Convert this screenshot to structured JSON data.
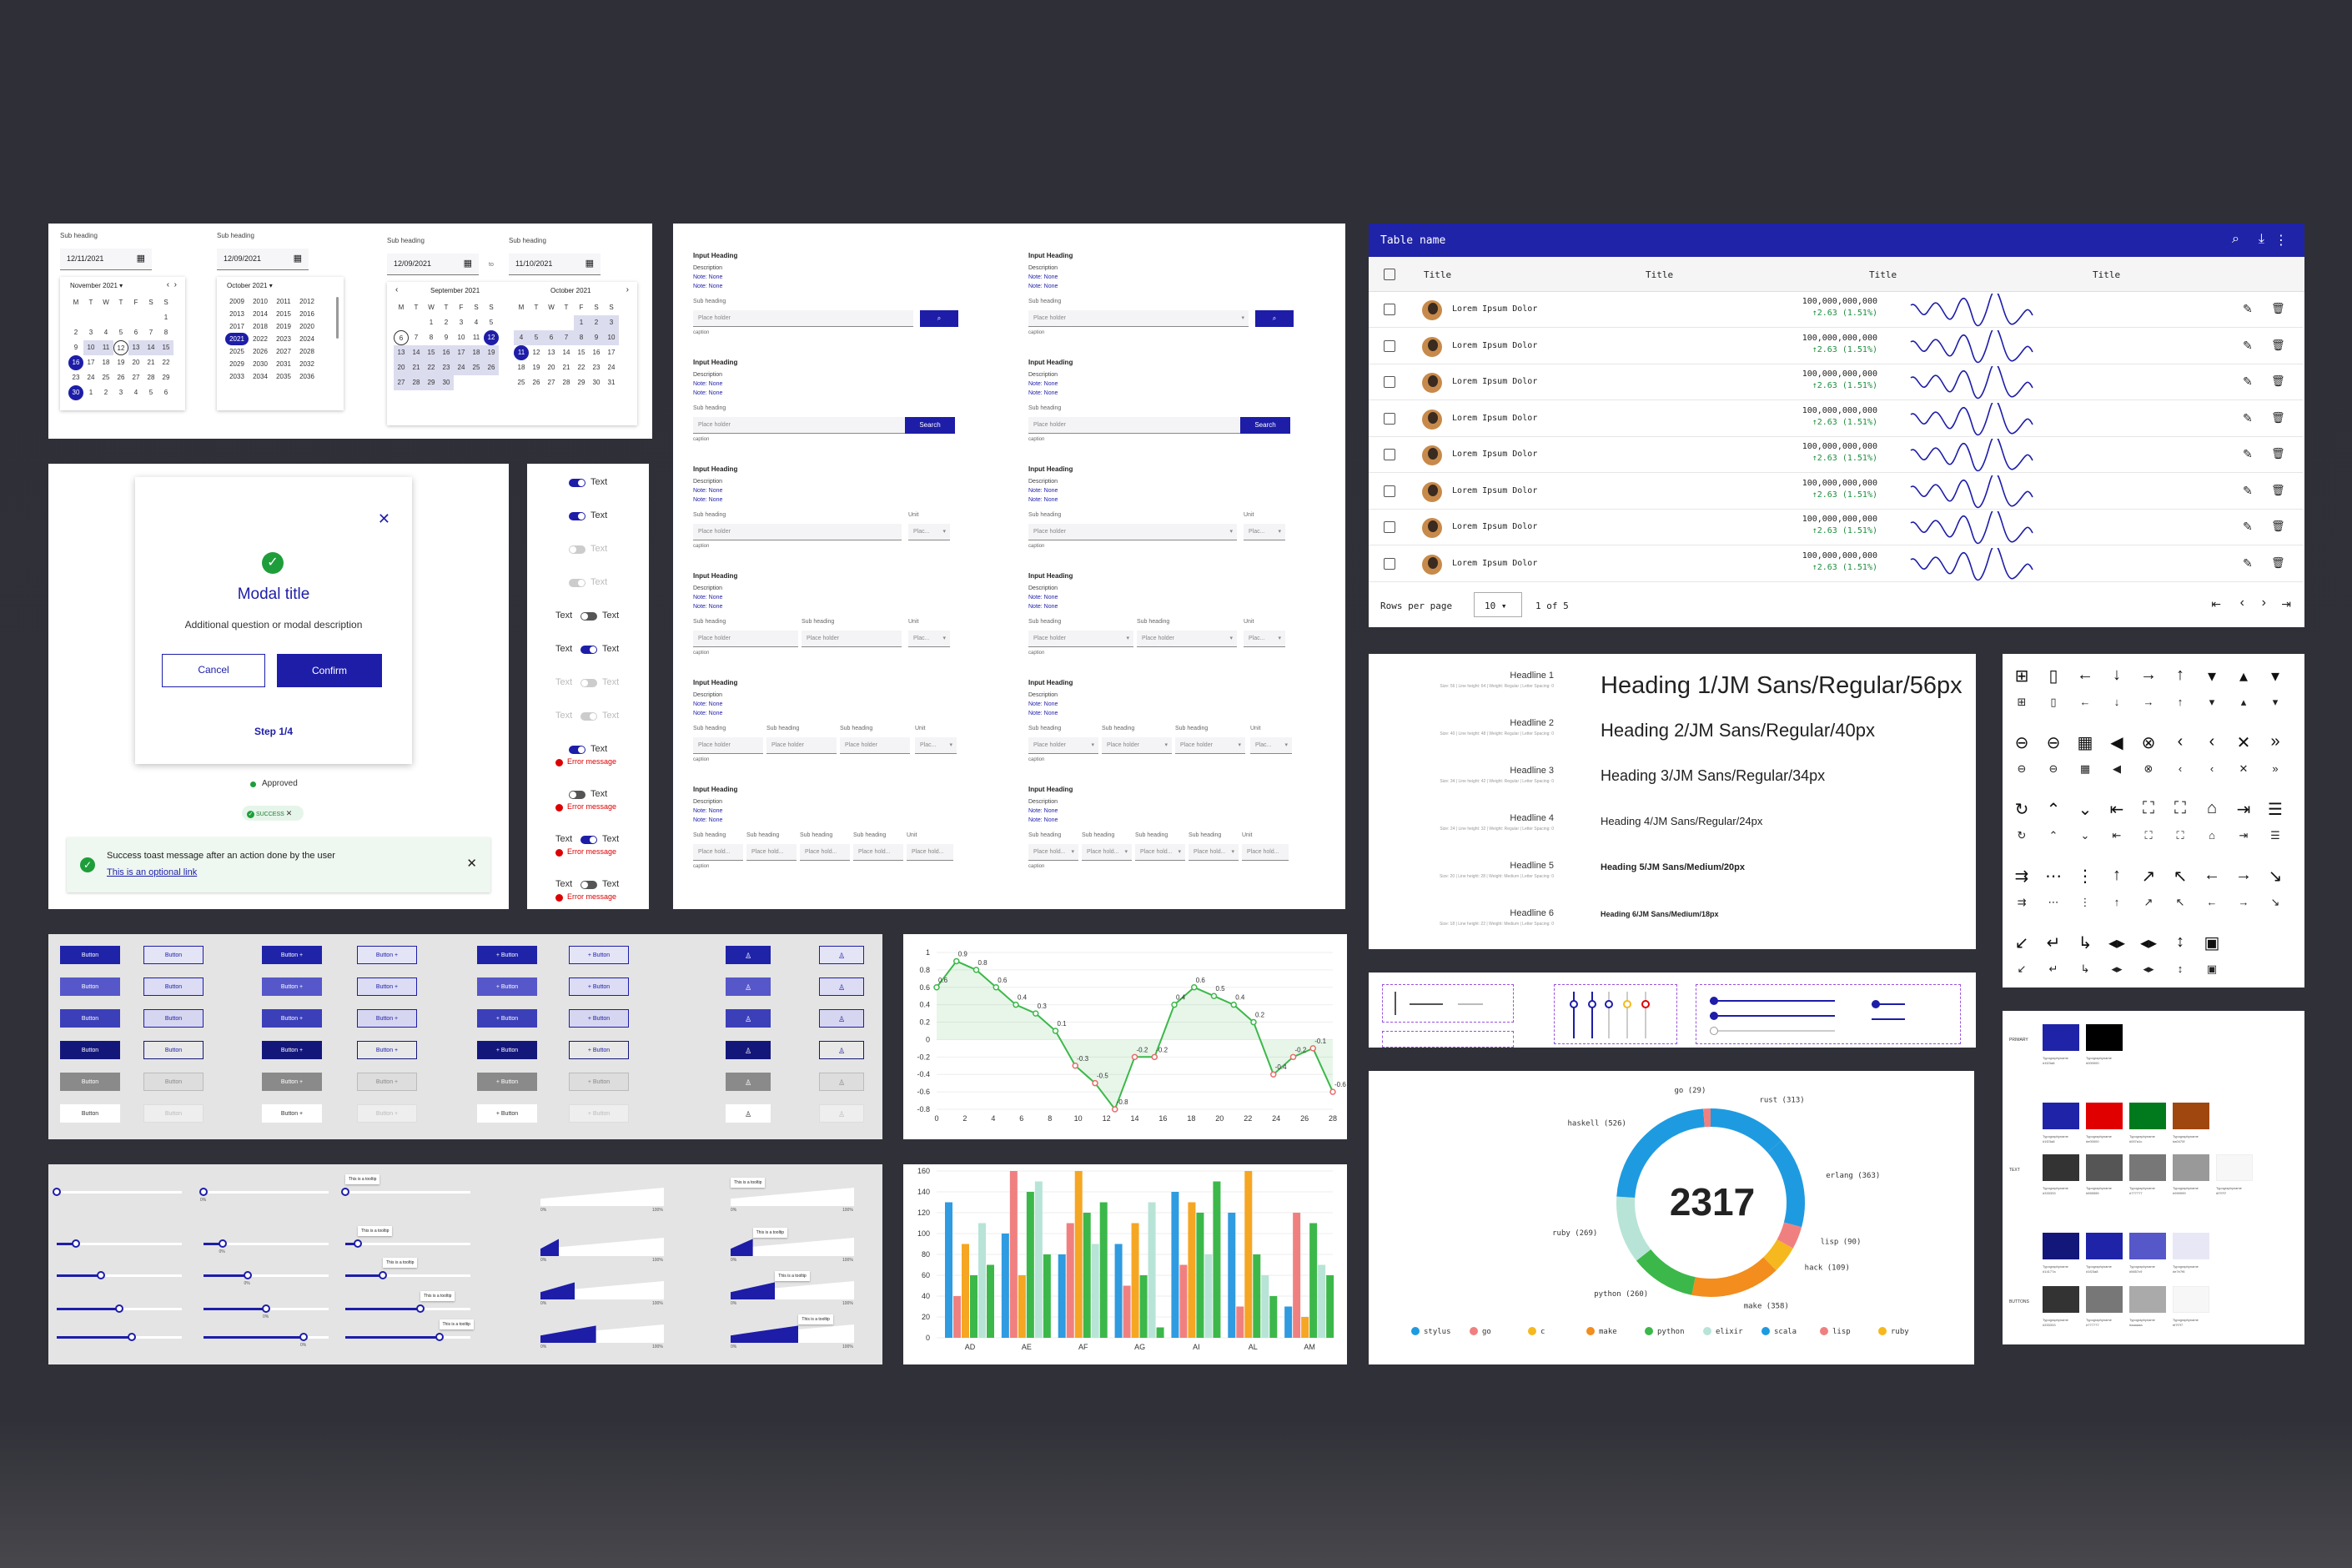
{
  "calendar": {
    "sub": "Sub heading",
    "c1": {
      "date": "12/11/2021",
      "month": "November 2021",
      "days": [
        "M",
        "T",
        "W",
        "T",
        "F",
        "S",
        "S"
      ],
      "cells": [
        "",
        "",
        "",
        "",
        "",
        "",
        "1",
        "2",
        "3",
        "4",
        "5",
        "6",
        "7",
        "8",
        "9",
        "10",
        "11",
        "12",
        "13",
        "14",
        "15",
        "16",
        "17",
        "18",
        "19",
        "20",
        "21",
        "22",
        "23",
        "24",
        "25",
        "26",
        "27",
        "28",
        "29",
        "30",
        "1",
        "2",
        "3",
        "4",
        "5",
        "6"
      ]
    },
    "c2": {
      "date": "12/09/2021",
      "month": "October 2021",
      "years": [
        "2009",
        "2010",
        "2011",
        "2012",
        "2013",
        "2014",
        "2015",
        "2016",
        "2017",
        "2018",
        "2019",
        "2020",
        "2021",
        "2022",
        "2023",
        "2024",
        "2025",
        "2026",
        "2027",
        "2028",
        "2029",
        "2030",
        "2031",
        "2032",
        "2033",
        "2034",
        "2035",
        "2036"
      ]
    },
    "c3": {
      "from": "12/09/2021",
      "to_label": "to",
      "to": "11/10/2021",
      "m1": "September 2021",
      "m2": "October 2021",
      "cells1": [
        "",
        "",
        "1",
        "2",
        "3",
        "4",
        "5",
        "6",
        "7",
        "8",
        "9",
        "10",
        "11",
        "12",
        "13",
        "14",
        "15",
        "16",
        "17",
        "18",
        "19",
        "20",
        "21",
        "22",
        "23",
        "24",
        "25",
        "26",
        "27",
        "28",
        "29",
        "30"
      ],
      "cells2": [
        "",
        "",
        "",
        "",
        "1",
        "2",
        "3",
        "4",
        "5",
        "6",
        "7",
        "8",
        "9",
        "10",
        "11",
        "12",
        "13",
        "14",
        "15",
        "16",
        "17",
        "18",
        "19",
        "20",
        "21",
        "22",
        "23",
        "24",
        "25",
        "26",
        "27",
        "28",
        "29",
        "30",
        "31"
      ]
    }
  },
  "inputs": {
    "heading": "Input Heading",
    "desc": "Description",
    "note1": "Note: None",
    "note2": "Note: None",
    "sub": "Sub heading",
    "ph": "Place holder",
    "ph_short": "Plac...",
    "ph_hold": "Place hold...",
    "caption": "caption",
    "unit": "Unit",
    "search": "Search"
  },
  "modal": {
    "title": "Modal title",
    "desc": "Additional question or modal description",
    "cancel": "Cancel",
    "confirm": "Confirm",
    "step": "Step 1/4",
    "approved": "Approved",
    "success_chip": "SUCCESS",
    "toast": "Success toast message after an action done by the user",
    "toast_link": "This is an optional link"
  },
  "toggles": {
    "text": "Text",
    "error": "Error message"
  },
  "table": {
    "title": "Table name",
    "cols": [
      "Title",
      "Title",
      "Title",
      "Title"
    ],
    "name": "Lorem Ipsum Dolor",
    "value": "100,000,000,000",
    "delta": "2.63 (1.51%)",
    "rows_label": "Rows per page",
    "rows_value": "10",
    "range": "1 of 5"
  },
  "typography": [
    {
      "label": "Headline 1",
      "meta": "Size: 56 | Line height: 64 | Weight: Regular | Letter Spacing: 0",
      "sample": "Heading 1/JM Sans/Regular/56px"
    },
    {
      "label": "Headline 2",
      "meta": "Size: 40 | Line height: 48 | Weight: Regular | Letter Spacing: 0",
      "sample": "Heading 2/JM Sans/Regular/40px"
    },
    {
      "label": "Headline 3",
      "meta": "Size: 34 | Line height: 42 | Weight: Regular | Letter Spacing: 0",
      "sample": "Heading 3/JM Sans/Regular/34px"
    },
    {
      "label": "Headline 4",
      "meta": "Size: 24 | Line height: 32 | Weight: Regular | Letter Spacing: 0",
      "sample": "Heading 4/JM Sans/Regular/24px"
    },
    {
      "label": "Headline 5",
      "meta": "Size: 20 | Line height: 28 | Weight: Medium | Letter Spacing: 0",
      "sample": "Heading 5/JM Sans/Medium/20px"
    },
    {
      "label": "Headline 6",
      "meta": "Size: 18 | Line height: 22 | Weight: Medium | Letter Spacing: 0",
      "sample": "Heading 6/JM Sans/Medium/18px"
    }
  ],
  "buttons": {
    "label": "Button",
    "label_plus": "Button +",
    "label_plus_pre": "+ Button"
  },
  "tooltip": "This is a tooltip",
  "percent": {
    "zero": "0%",
    "full": "100%"
  },
  "donut": {
    "total": "2317",
    "slices": [
      {
        "name": "rust",
        "value": 313,
        "color": "#1e9be0"
      },
      {
        "name": "erlang",
        "value": 363,
        "color": "#1e9be0"
      },
      {
        "name": "lisp",
        "value": 90,
        "color": "#f08080"
      },
      {
        "name": "hack",
        "value": 109,
        "color": "#f5b81e"
      },
      {
        "name": "make",
        "value": 358,
        "color": "#f28d1e"
      },
      {
        "name": "python",
        "value": 260,
        "color": "#3cb84a"
      },
      {
        "name": "ruby",
        "value": 269,
        "color": "#b7e4d6"
      },
      {
        "name": "haskell",
        "value": 526,
        "color": "#1e9be0"
      },
      {
        "name": "go",
        "value": 29,
        "color": "#f08080"
      }
    ],
    "legend": [
      {
        "name": "stylus",
        "color": "#1e9be0"
      },
      {
        "name": "go",
        "color": "#f08080"
      },
      {
        "name": "c",
        "color": "#f5b81e"
      },
      {
        "name": "make",
        "color": "#f28d1e"
      },
      {
        "name": "python",
        "color": "#3cb84a"
      },
      {
        "name": "elixir",
        "color": "#b7e4d6"
      },
      {
        "name": "scala",
        "color": "#1e9be0"
      },
      {
        "name": "lisp",
        "color": "#f08080"
      },
      {
        "name": "ruby",
        "color": "#f5b81e"
      }
    ]
  },
  "chart_data": [
    {
      "type": "line",
      "x": [
        0,
        1,
        2,
        3,
        4,
        5,
        6,
        7,
        8,
        9,
        10,
        11,
        12,
        13,
        14,
        15,
        16,
        17,
        18,
        19,
        20,
        21,
        22,
        23,
        24,
        25,
        26,
        27,
        28,
        29
      ],
      "values": [
        0.6,
        0.9,
        0.8,
        0.6,
        0.4,
        0.3,
        0.1,
        -0.3,
        -0.5,
        -0.8,
        -0.2,
        -0.2,
        0.4,
        0.6,
        0.5,
        0.4,
        0.2,
        -0.4,
        -0.2,
        -0.1,
        -0.6
      ],
      "ylim": [
        -0.8,
        1
      ],
      "xticks": [
        "0",
        "2",
        "4",
        "6",
        "8",
        "10",
        "12",
        "14",
        "16",
        "18",
        "20",
        "22",
        "24",
        "26",
        "28"
      ],
      "yticks": [
        "1",
        "0.8",
        "0.6",
        "0.4",
        "0.2",
        "0",
        "-0.2",
        "-0.4",
        "-0.6",
        "-0.8"
      ],
      "labels": [
        "0.9",
        "0.8",
        "0.6",
        "0.4",
        "0.3",
        "-0.3",
        "-0.5",
        "-0.8",
        "-0.2",
        "-0.2",
        "0.4",
        "0.6",
        "0.5",
        "0.4",
        "0.2",
        "-0.4",
        "-0.2",
        "-0.1",
        "-0.6"
      ]
    },
    {
      "type": "bar",
      "categories": [
        "AD",
        "AE",
        "AF",
        "AG",
        "AI",
        "AL",
        "AM"
      ],
      "ylim": [
        0,
        160
      ],
      "yticks": [
        "160",
        "140",
        "120",
        "100",
        "80",
        "60",
        "40",
        "20",
        "0"
      ],
      "series": [
        {
          "color": "#2f9be0",
          "values": [
            130,
            100,
            80,
            90,
            140,
            120,
            30
          ]
        },
        {
          "color": "#f08080",
          "values": [
            40,
            160,
            110,
            50,
            70,
            30,
            120
          ]
        },
        {
          "color": "#f5a623",
          "values": [
            90,
            60,
            160,
            110,
            130,
            160,
            20
          ]
        },
        {
          "color": "#3cb84a",
          "values": [
            60,
            140,
            120,
            60,
            120,
            80,
            110
          ]
        },
        {
          "color": "#b7e4d6",
          "values": [
            110,
            150,
            90,
            130,
            80,
            60,
            70
          ]
        },
        {
          "color": "#3cb84a",
          "values": [
            70,
            80,
            130,
            10,
            150,
            40,
            60
          ]
        }
      ]
    }
  ],
  "colors": {
    "labels": [
      "PRIMARY",
      "TEXT",
      "BUTTONS"
    ],
    "row1": [
      "#1f23a8",
      "#000000"
    ],
    "row2": [
      "#1f23a8",
      "#e00000",
      "#007a1c",
      "#a0470f"
    ],
    "row3": [
      "#333333",
      "#555555",
      "#777777",
      "#999999",
      "#f7f7f7"
    ],
    "row4": [
      "#14177a",
      "#1f23a8",
      "#5657c9",
      "#e7e7f6"
    ],
    "row5": [
      "#333333",
      "#777777",
      "#aaaaaa",
      "#f7f7f7"
    ],
    "swatch_label": "Typographyname",
    "swatch_hex": "#000000"
  }
}
